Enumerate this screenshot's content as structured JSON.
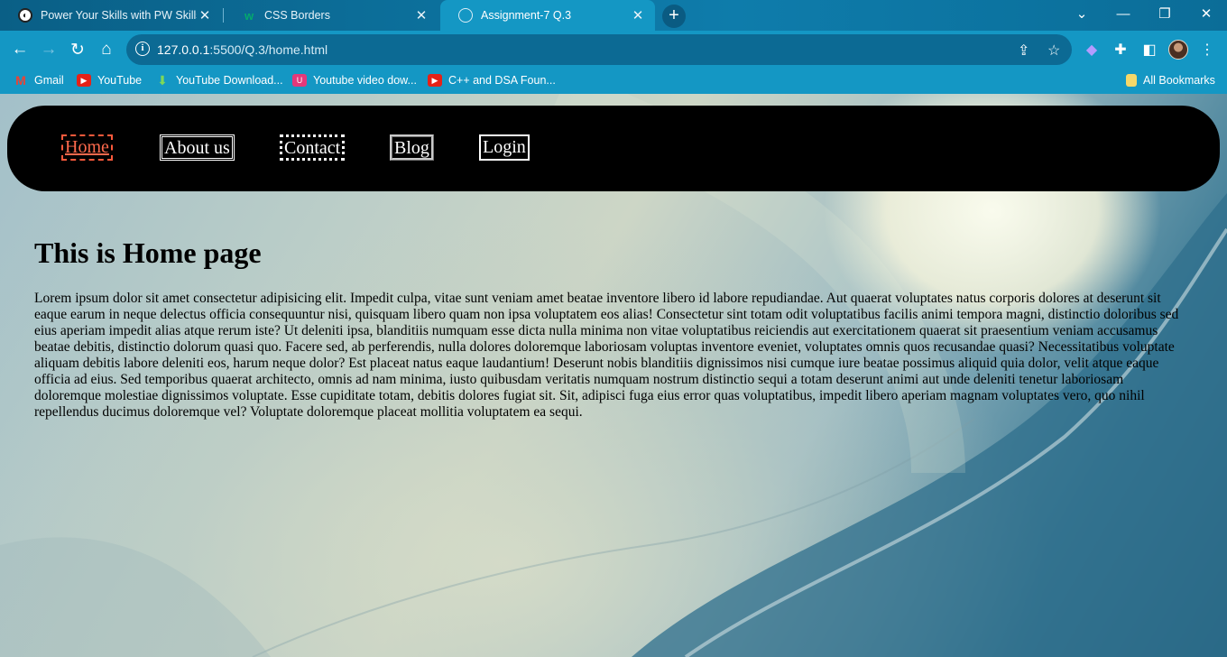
{
  "browser": {
    "tabs": [
      {
        "title": "Power Your Skills with PW Skills",
        "icon": "pw-skills-icon",
        "active": false
      },
      {
        "title": "CSS Borders",
        "icon": "w3schools-icon",
        "active": false
      },
      {
        "title": "Assignment-7 Q.3",
        "icon": "globe-icon",
        "active": true
      }
    ],
    "tab_close_glyph": "✕",
    "new_tab_glyph": "+",
    "url_host": "127.0.0.1",
    "url_path": ":5500/Q.3/home.html",
    "bookmarks": [
      {
        "label": "Gmail",
        "icon": "gmail-icon"
      },
      {
        "label": "YouTube",
        "icon": "youtube-icon"
      },
      {
        "label": "YouTube Download...",
        "icon": "download-icon"
      },
      {
        "label": "Youtube video dow...",
        "icon": "u-icon"
      },
      {
        "label": "C++ and DSA Foun...",
        "icon": "youtube-icon"
      }
    ],
    "all_bookmarks_label": "All Bookmarks"
  },
  "page": {
    "nav": [
      {
        "label": "Home",
        "border": "dashed",
        "color": "#ff6a4d"
      },
      {
        "label": "About us",
        "border": "double",
        "color": "#ffffff"
      },
      {
        "label": "Contact",
        "border": "dotted",
        "color": "#ffffff"
      },
      {
        "label": "Blog",
        "border": "ridge",
        "color": "#ffffff"
      },
      {
        "label": "Login",
        "border": "solid",
        "color": "#ffffff"
      }
    ],
    "heading": "This is Home page",
    "body_text": "Lorem ipsum dolor sit amet consectetur adipisicing elit. Impedit culpa, vitae sunt veniam amet beatae inventore libero id labore repudiandae. Aut quaerat voluptates natus corporis dolores at deserunt sit eaque earum in neque delectus officia consequuntur nisi, quisquam libero quam non ipsa voluptatem eos alias! Consectetur sint totam odit voluptatibus facilis animi tempora magni, distinctio doloribus sed eius aperiam impedit alias atque rerum iste? Ut deleniti ipsa, blanditiis numquam esse dicta nulla minima non vitae voluptatibus reiciendis aut exercitationem quaerat sit praesentium veniam accusamus beatae debitis, distinctio dolorum quasi quo. Facere sed, ab perferendis, nulla dolores doloremque laboriosam voluptas inventore eveniet, voluptates omnis quos recusandae quasi? Necessitatibus voluptate aliquam debitis labore deleniti eos, harum neque dolor? Est placeat natus eaque laudantium! Deserunt nobis blanditiis dignissimos nisi cumque iure beatae possimus aliquid quia dolor, velit atque eaque officia ad eius. Sed temporibus quaerat architecto, omnis ad nam minima, iusto quibusdam veritatis numquam nostrum distinctio sequi a totam deserunt animi aut unde deleniti tenetur laboriosam doloremque molestiae dignissimos voluptate. Esse cupiditate totam, debitis dolores fugiat sit. Sit, adipisci fuga eius error quas voluptatibus, impedit libero aperiam magnam voluptates vero, quo nihil repellendus ducimus doloremque vel? Voluptate doloremque placeat mollitia voluptatem ea sequi."
  },
  "colors": {
    "chrome_bg": "#1497c4",
    "tabbar_bg": "#0a5f86",
    "nav_bg": "#000000",
    "home_link": "#ff6a4d"
  }
}
